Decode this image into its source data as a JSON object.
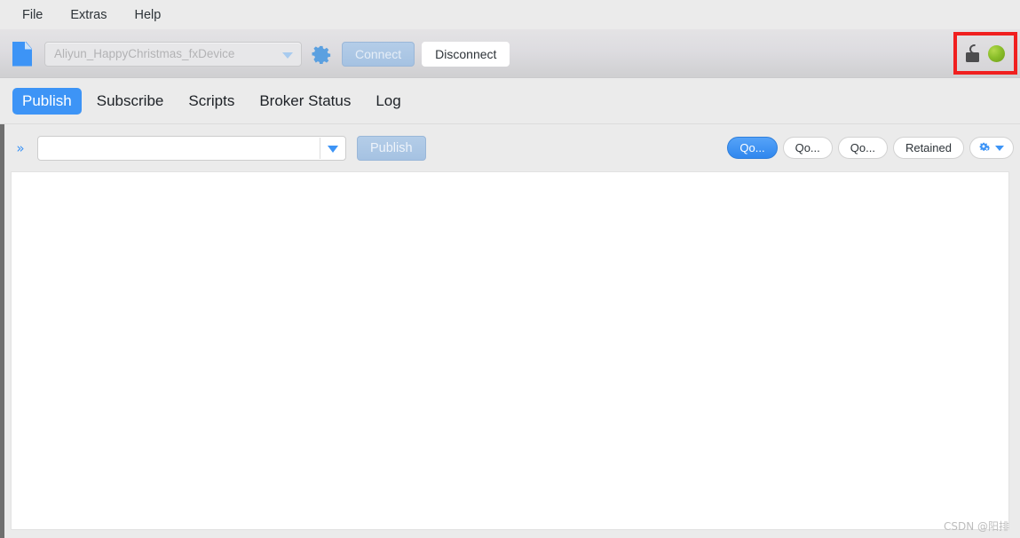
{
  "menubar": {
    "items": [
      {
        "label": "File",
        "name": "menu-file"
      },
      {
        "label": "Extras",
        "name": "menu-extras"
      },
      {
        "label": "Help",
        "name": "menu-help"
      }
    ]
  },
  "toolbar": {
    "doc_icon": "new-document-icon",
    "connection_combo": {
      "value": "Aliyun_HappyChristmas_fxDevice",
      "placeholder": "Aliyun_HappyChristmas_fxDevice",
      "caret_icon": "chevron-down-icon"
    },
    "settings_icon": "gear-icon",
    "connect_label": "Connect",
    "disconnect_label": "Disconnect",
    "status": {
      "lock_icon": "unlocked-padlock-icon",
      "connection_dot": "green-status-dot",
      "dot_color": "#8bbf2b",
      "highlight_color": "#f01f1f"
    }
  },
  "tabs": [
    {
      "label": "Publish",
      "name": "tab-publish",
      "active": true
    },
    {
      "label": "Subscribe",
      "name": "tab-subscribe",
      "active": false
    },
    {
      "label": "Scripts",
      "name": "tab-scripts",
      "active": false
    },
    {
      "label": "Broker Status",
      "name": "tab-broker-status",
      "active": false
    },
    {
      "label": "Log",
      "name": "tab-log",
      "active": false
    }
  ],
  "publish_row": {
    "expand_icon": "chevron-double-right-icon",
    "topic_input": {
      "value": "",
      "placeholder": ""
    },
    "topic_caret_icon": "chevron-down-icon",
    "publish_label": "Publish",
    "options": [
      {
        "label": "Qo...",
        "name": "qos0-button",
        "active": true
      },
      {
        "label": "Qo...",
        "name": "qos1-button",
        "active": false
      },
      {
        "label": "Qo...",
        "name": "qos2-button",
        "active": false
      },
      {
        "label": "Retained",
        "name": "retained-button",
        "active": false
      }
    ],
    "settings_pill": {
      "icon": "gears-icon",
      "caret_icon": "chevron-down-icon"
    }
  },
  "content": {
    "body_text": ""
  },
  "watermark": "CSDN @阳排",
  "colors": {
    "accent": "#3d94f6",
    "window_bg": "#ebebeb",
    "panel_bg": "#ffffff"
  }
}
